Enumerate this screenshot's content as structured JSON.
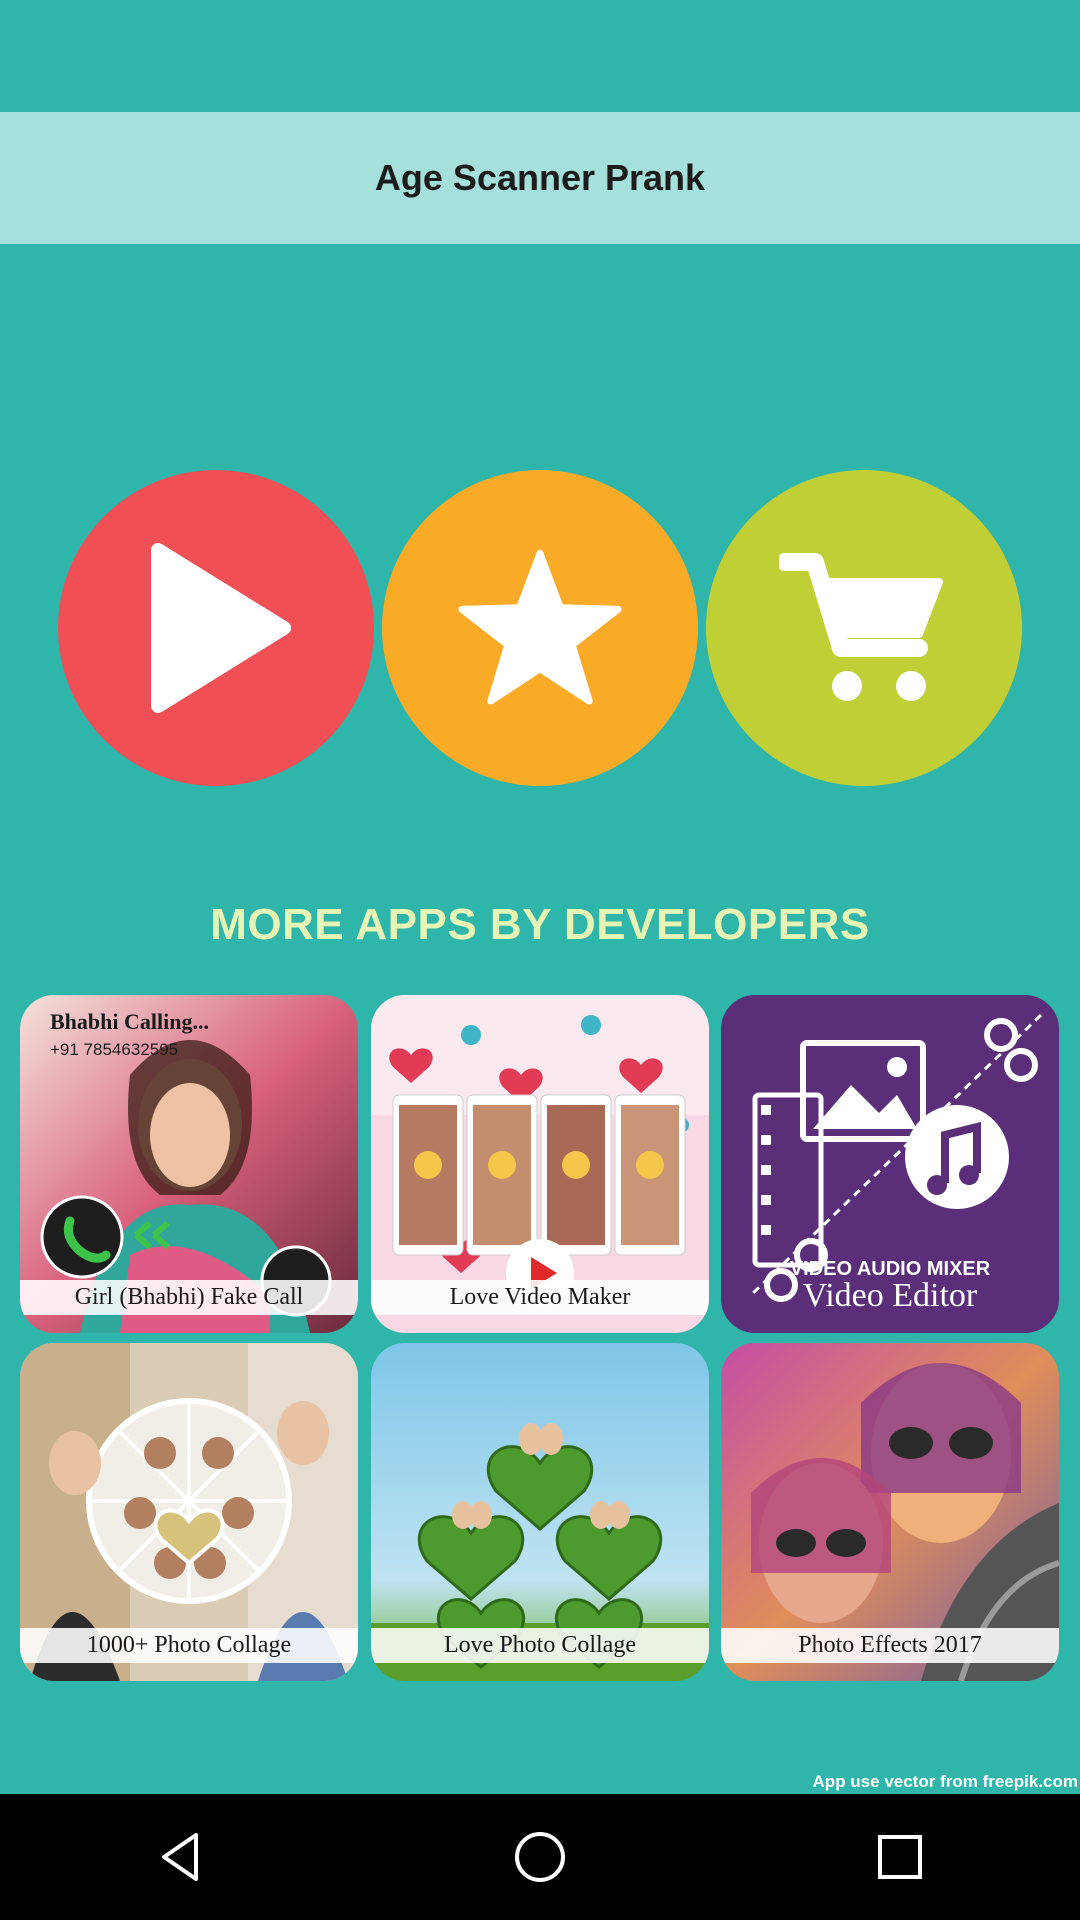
{
  "header": {
    "title": "Age Scanner Prank"
  },
  "actions": [
    {
      "name": "play",
      "icon": "play-icon",
      "color": "#ef4f55"
    },
    {
      "name": "rate",
      "icon": "star-icon",
      "color": "#f9ab27"
    },
    {
      "name": "shop",
      "icon": "cart-icon",
      "color": "#bfcf35"
    }
  ],
  "more_apps": {
    "heading": "MORE APPS BY DEVELOPERS",
    "apps": [
      {
        "caption": "Girl (Bhabhi) Fake Call",
        "top_text": "Bhabhi Calling...",
        "phone": "+91 7854632595"
      },
      {
        "caption": "Love Video Maker"
      },
      {
        "caption": "Video Editor",
        "banner": "VIDEO AUDIO MIXER"
      },
      {
        "caption": "1000+ Photo Collage"
      },
      {
        "caption": "Love Photo Collage"
      },
      {
        "caption": "Photo Effects 2017"
      }
    ]
  },
  "footer": {
    "credit": "App use vector from freepik.com"
  },
  "nav": {
    "back": "back-icon",
    "home": "home-icon",
    "recents": "recents-icon"
  }
}
